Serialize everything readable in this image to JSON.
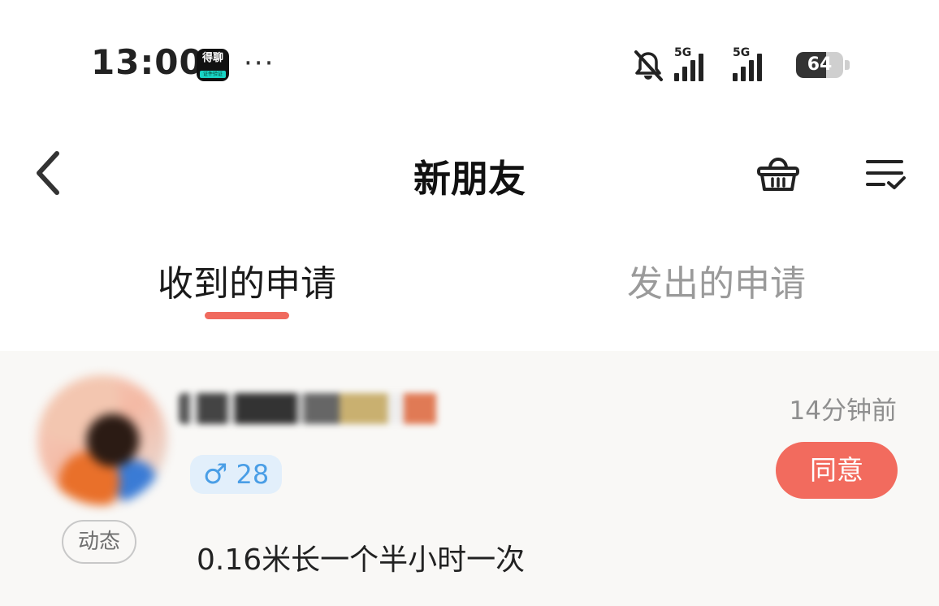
{
  "status_bar": {
    "time": "13:00",
    "app_badge_text": "得聊",
    "app_badge_sub": "证件验证",
    "more_dots": "···",
    "signal_1_label": "5G",
    "signal_2_label": "5G",
    "battery_level": "64",
    "battery_fraction": 0.64,
    "icons": [
      "bell-off-icon",
      "signal-icon",
      "signal-icon",
      "battery-icon"
    ]
  },
  "header": {
    "title": "新朋友",
    "icons": [
      "chevron-left-icon",
      "basket-icon",
      "list-check-icon"
    ]
  },
  "tabs": [
    {
      "label": "收到的申请",
      "active": true
    },
    {
      "label": "发出的申请",
      "active": false
    }
  ],
  "requests": [
    {
      "nickname": "",
      "gender_symbol": "♂",
      "age": "28",
      "time": "14分钟前",
      "accept_label": "同意",
      "source_tag": "动态",
      "message": "0.16米长一个半小时一次"
    }
  ],
  "colors": {
    "accent": "#f26b5e",
    "tab_indicator": "#f06a5e",
    "male_badge_bg": "#e2effb",
    "male_badge_text": "#4a9ee6",
    "list_bg": "#f9f8f6"
  }
}
